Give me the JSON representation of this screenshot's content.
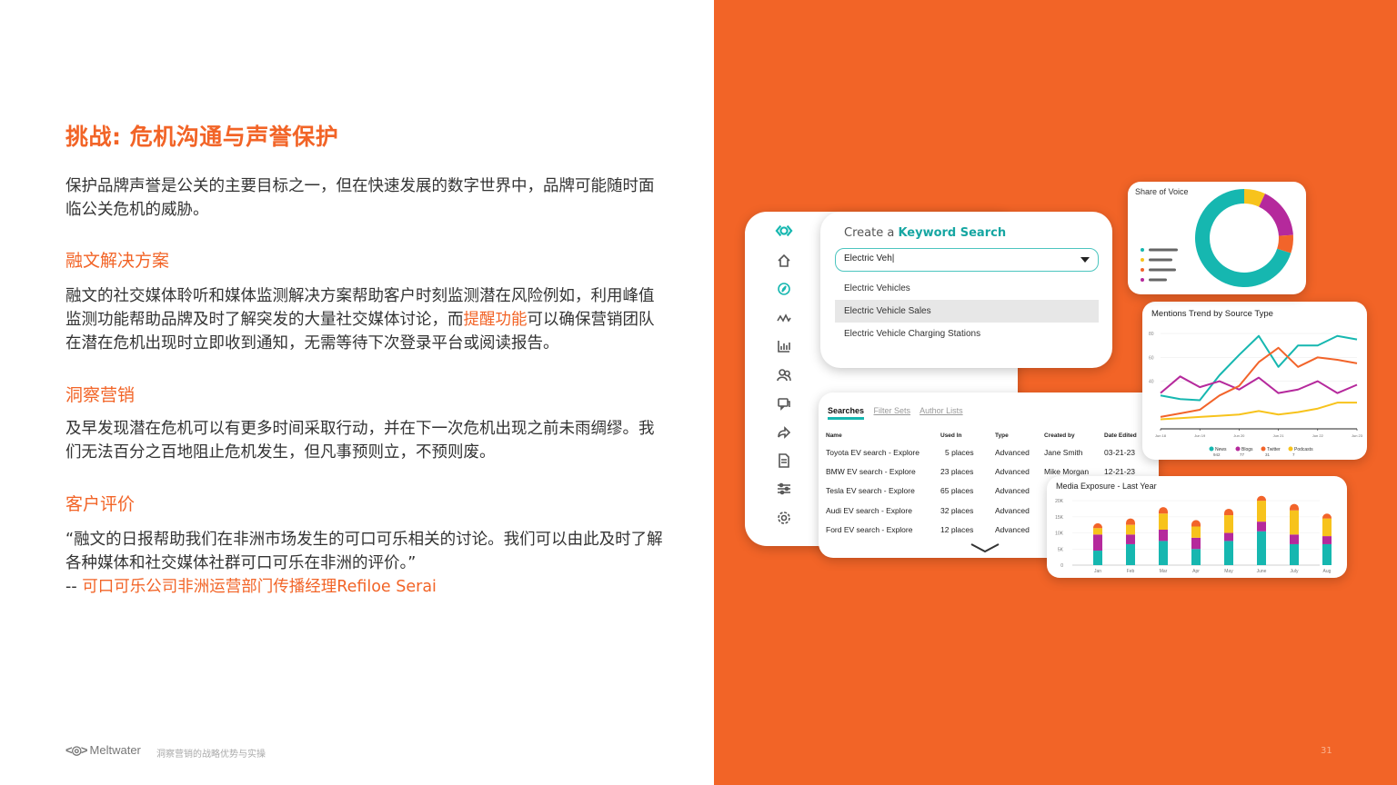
{
  "slide": {
    "heading": "挑战: 危机沟通与声誉保护",
    "intro": "保护品牌声誉是公关的主要目标之一，但在快速发展的数字世界中，品牌可能随时面临公关危机的威胁。",
    "section1_title": "融文解决方案",
    "section1_text_a": "融文的社交媒体聆听和媒体监测解决方案帮助客户时刻监测潜在风险例如，利用峰值监测功能帮助品牌及时了解突发的大量社交媒体讨论，而",
    "section1_highlight": "提醒功能",
    "section1_text_b": "可以确保营销团队在潜在危机出现时立即收到通知，无需等待下次登录平台或阅读报告。",
    "section2_title": "洞察营销",
    "section2_text": "及早发现潜在危机可以有更多时间采取行动，并在下一次危机出现之前未雨绸缪。我们无法百分之百地阻止危机发生，但凡事预则立，不预则废。",
    "section3_title": "客户评价",
    "quote": "“融文的日报帮助我们在非洲市场发生的可口可乐相关的讨论。我们可以由此及时了解各种媒体和社交媒体社群可口可乐在非洲的评价。”",
    "attribution_prefix": "-- ",
    "attribution": "可口可乐公司非洲运营部门传播经理Refiloe Serai",
    "footer_brand": "Meltwater",
    "footer_sub": "洞察营销的战略优势与实操",
    "page_number": "31"
  },
  "colors": {
    "accent": "#f26427",
    "teal": "#16b7b0",
    "magenta": "#b5299c",
    "yellow": "#f7c31c",
    "orange": "#f2642a"
  },
  "sidebar_icons": [
    "logo-icon",
    "home-icon",
    "compass-icon",
    "trend-icon",
    "bar-chart-icon",
    "people-icon",
    "chat-icon",
    "share-icon",
    "document-icon",
    "sliders-icon",
    "gear-icon"
  ],
  "keyword_search": {
    "title_prefix": "Create a ",
    "title_bold": "Keyword Search",
    "input_value": "Electric Veh|",
    "options": [
      "Electric Vehicles",
      "Electric Vehicle Sales",
      "Electric Vehicle Charging Stations"
    ],
    "selected_index": 1
  },
  "share_of_voice": {
    "title": "Share of Voice"
  },
  "mentions_trend": {
    "title": "Mentions Trend by Source Type",
    "legend": [
      {
        "name": "News",
        "value": "942",
        "color": "#16b7b0"
      },
      {
        "name": "Blogs",
        "value": "77",
        "color": "#b5299c"
      },
      {
        "name": "Twitter",
        "value": "31",
        "color": "#f2642a"
      },
      {
        "name": "Podcasts",
        "value": "7",
        "color": "#f7c31c"
      }
    ],
    "x_ticks": [
      "Jun 18",
      "Jun 19",
      "Jun 20",
      "Jun 21",
      "Jun 22",
      "Jun 23"
    ],
    "y_ticks": [
      "80",
      "60",
      "40"
    ]
  },
  "searches": {
    "tabs": [
      "Searches",
      "Filter Sets",
      "Author Lists"
    ],
    "columns": [
      "Name",
      "Used In",
      "Type",
      "Created by",
      "Date Edited"
    ],
    "rows": [
      [
        "Toyota EV search - Explore",
        "5 places",
        "Advanced",
        "Jane Smith",
        "03-21-23"
      ],
      [
        "BMW EV search - Explore",
        "23 places",
        "Advanced",
        "Mike Morgan",
        "12-21-23"
      ],
      [
        "Tesla EV search - Explore",
        "65 places",
        "Advanced",
        "",
        ""
      ],
      [
        "Audi EV search - Explore",
        "32 places",
        "Advanced",
        "",
        ""
      ],
      [
        "Ford EV search - Explore",
        "12 places",
        "Advanced",
        "",
        ""
      ]
    ]
  },
  "media_exposure": {
    "title": "Media Exposure - Last Year",
    "y_ticks": [
      "20K",
      "15K",
      "10K",
      "5K",
      "0"
    ],
    "months": [
      "Jan",
      "Feb",
      "Mar",
      "Apr",
      "May",
      "June",
      "July",
      "Aug"
    ]
  },
  "chart_data": [
    {
      "type": "pie",
      "title": "Share of Voice",
      "categories": [
        "Teal",
        "Yellow",
        "Magenta",
        "Orange"
      ],
      "values": [
        70,
        7,
        17,
        6
      ]
    },
    {
      "type": "line",
      "title": "Mentions Trend by Source Type",
      "x": [
        "Jun 18",
        "",
        "Jun 19",
        "",
        "Jun 20",
        "",
        "Jun 21",
        "",
        "Jun 22",
        "",
        "Jun 23"
      ],
      "ylim": [
        0,
        90
      ],
      "series": [
        {
          "name": "News",
          "values": [
            28,
            25,
            24,
            45,
            62,
            78,
            52,
            70,
            70,
            78,
            75
          ]
        },
        {
          "name": "Blogs",
          "values": [
            30,
            44,
            35,
            40,
            33,
            43,
            30,
            33,
            40,
            30,
            37
          ]
        },
        {
          "name": "Twitter",
          "values": [
            10,
            13,
            16,
            28,
            36,
            56,
            68,
            52,
            60,
            58,
            55
          ]
        },
        {
          "name": "Podcasts",
          "values": [
            8,
            9,
            10,
            11,
            12,
            15,
            12,
            14,
            17,
            22,
            22
          ]
        }
      ]
    },
    {
      "type": "bar",
      "title": "Media Exposure - Last Year",
      "categories": [
        "Jan",
        "Feb",
        "Mar",
        "Apr",
        "May",
        "June",
        "July",
        "Aug"
      ],
      "ylim": [
        0,
        22000
      ],
      "series": [
        {
          "name": "Teal",
          "values": [
            4500,
            6500,
            7500,
            5000,
            7500,
            10500,
            6500,
            6500
          ]
        },
        {
          "name": "Magenta",
          "values": [
            5000,
            3000,
            3500,
            3500,
            2500,
            3000,
            3000,
            2500
          ]
        },
        {
          "name": "Yellow",
          "values": [
            2000,
            3000,
            5000,
            3500,
            5500,
            6500,
            7500,
            5500
          ]
        },
        {
          "name": "Orange",
          "values": [
            1500,
            2000,
            2000,
            2000,
            2000,
            1500,
            2000,
            1500
          ]
        }
      ]
    }
  ]
}
